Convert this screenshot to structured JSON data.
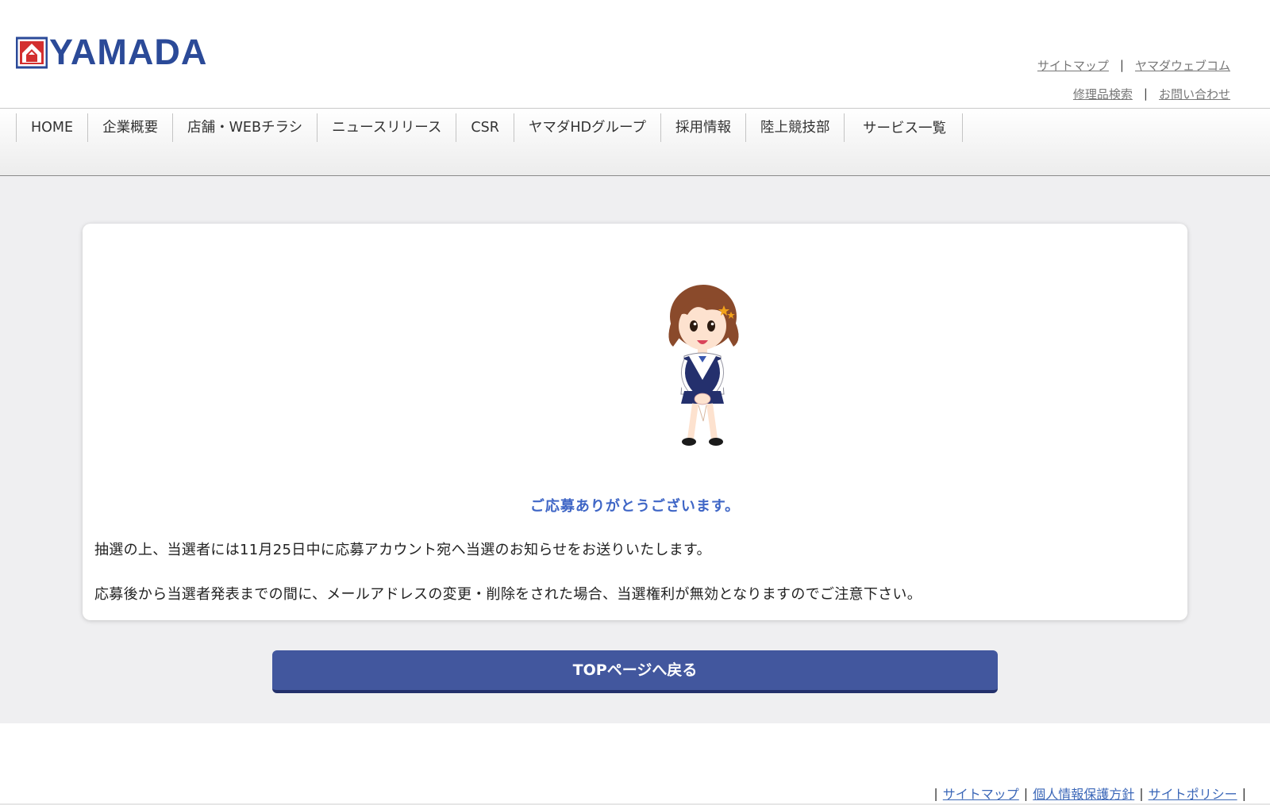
{
  "header": {
    "logo_text": "YAMADA",
    "links_row1": [
      "サイトマップ",
      "ヤマダウェブコム"
    ],
    "links_row2": [
      "修理品検索",
      "お問い合わせ"
    ],
    "separator": "|"
  },
  "nav": {
    "items": [
      "HOME",
      "企業概要",
      "店舗・WEBチラシ",
      "ニュースリリース",
      "CSR",
      "ヤマダHDグループ",
      "採用情報",
      "陸上競技部",
      "サービス一覧"
    ]
  },
  "main": {
    "thanks": "ご応募ありがとうございます。",
    "message1": "抽選の上、当選者には11月25日中に応募アカウント宛へ当選のお知らせをお送りいたします。",
    "message2": "応募後から当選者発表までの間に、メールアドレスの変更・削除をされた場合、当選権利が無効となりますのでご注意下さい。",
    "top_button": "TOPページへ戻る"
  },
  "footer": {
    "separator": "|",
    "links": [
      "サイトマップ",
      "個人情報保護方針",
      "サイトポリシー"
    ]
  },
  "colors": {
    "brand_blue": "#2b4a98",
    "logo_red": "#d32f2f",
    "accent_text": "#3f66c6",
    "button": "#42579e",
    "link": "#3b67b8"
  },
  "icons": {
    "logo_mark": "yamada-house-icon",
    "mascot": "mascot-girl-illustration"
  }
}
